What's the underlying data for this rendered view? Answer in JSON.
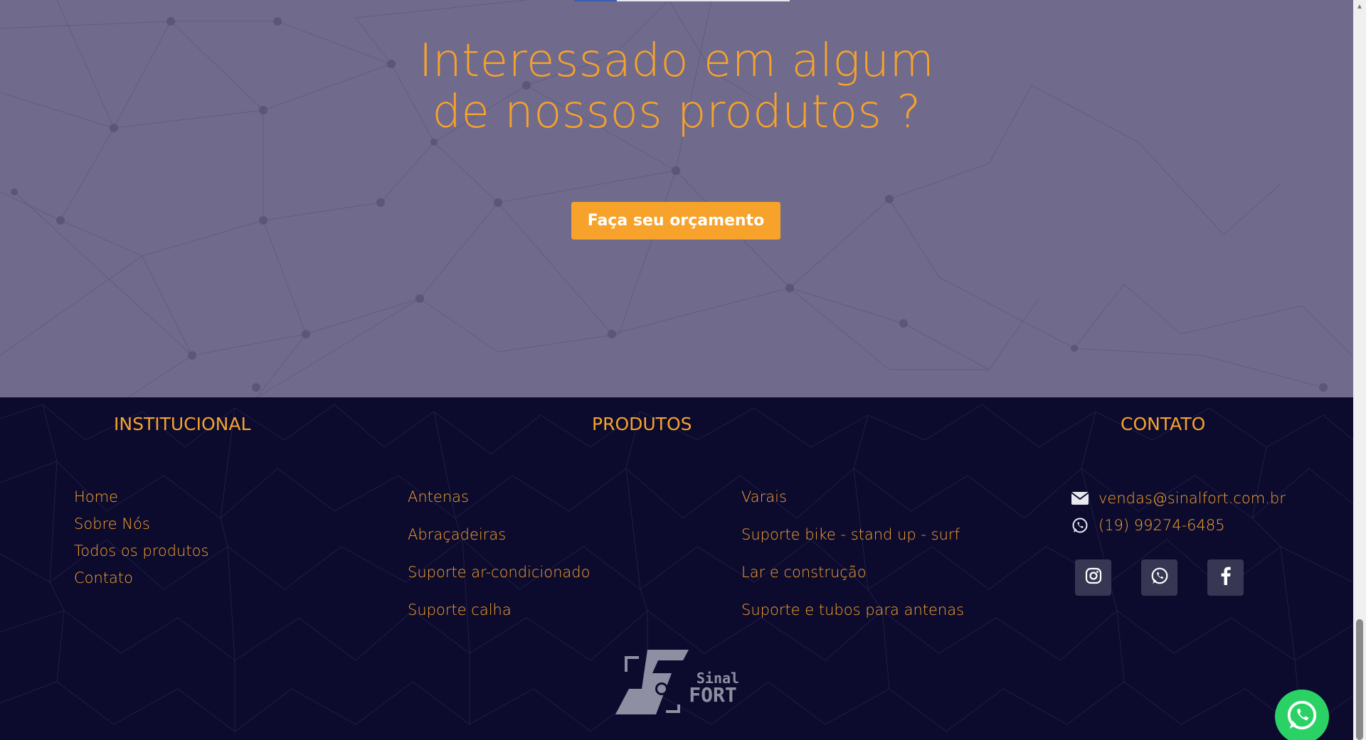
{
  "cta": {
    "title_line1": "Interessado em algum",
    "title_line2": "de nossos produtos ?",
    "button_label": "Faça seu orçamento"
  },
  "footer": {
    "institucional": {
      "title": "INSTITUCIONAL",
      "links": [
        "Home",
        "Sobre Nós",
        "Todos os produtos",
        "Contato"
      ]
    },
    "produtos": {
      "title": "PRODUTOS",
      "col1": [
        "Antenas",
        "Abraçadeiras",
        "Suporte ar-condicionado",
        "Suporte calha"
      ],
      "col2": [
        "Varais",
        "Suporte bike - stand up - surf",
        "Lar e construção",
        "Suporte e tubos para antenas"
      ]
    },
    "contato": {
      "title": "CONTATO",
      "email": "vendas@sinalfort.com.br",
      "phone": "(19) 99274-6485",
      "socials": [
        "instagram-icon",
        "whatsapp-icon",
        "facebook-icon"
      ]
    },
    "logo": {
      "text_top": "Sinal",
      "text_bottom": "FORT"
    }
  },
  "colors": {
    "accent": "#f6a22b",
    "cta_background": "#706a8c",
    "footer_background": "#0c0b2e",
    "social_button": "#373754",
    "whatsapp_green": "#2ad266"
  }
}
